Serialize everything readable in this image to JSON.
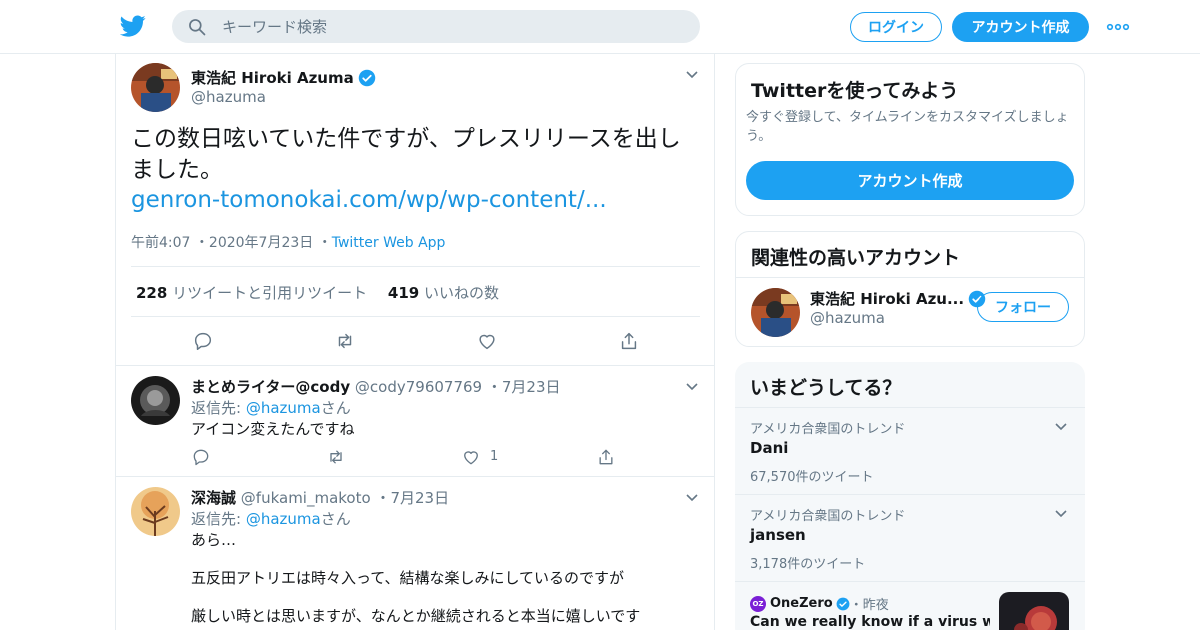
{
  "header": {
    "search_placeholder": "キーワード検索",
    "login_label": "ログイン",
    "signup_label": "アカウント作成"
  },
  "tweet": {
    "author_name": "東浩紀 Hiroki Azuma",
    "author_handle": "@hazuma",
    "text": "この数日呟いていた件ですが、プレスリリースを出しました。",
    "link": "genron-tomonokai.com/wp/wp-content/...",
    "time": "午前4:07",
    "date": "2020年7月23日",
    "source": "Twitter Web App",
    "retweet_count": "228",
    "retweet_label": "リツイートと引用リツイート",
    "like_count": "419",
    "like_label": "いいねの数"
  },
  "replies": [
    {
      "name": "まとめライター@cody",
      "handle": "@cody79607769",
      "date": "7月23日",
      "reply_to_prefix": "返信先: ",
      "reply_to_handle": "@hazuma",
      "reply_to_suffix": "さん",
      "text": "アイコン変えたんですね",
      "like_count": "1"
    },
    {
      "name": "深海誠",
      "handle": "@fukami_makoto",
      "date": "7月23日",
      "reply_to_prefix": "返信先: ",
      "reply_to_handle": "@hazuma",
      "reply_to_suffix": "さん",
      "line1": "あら…",
      "line2": "五反田アトリエは時々入って、結構な楽しみにしているのですが",
      "line3": "厳しい時とは思いますが、なんとか継続されると本当に嬉しいです"
    }
  ],
  "sidebar": {
    "signup_card": {
      "title": "Twitterを使ってみよう",
      "desc": "今すぐ登録して、タイムラインをカスタマイズしましょう。",
      "button": "アカウント作成"
    },
    "related": {
      "title": "関連性の高いアカウント",
      "name": "東浩紀 Hiroki Azu...",
      "handle": "@hazuma",
      "follow_label": "フォロー"
    },
    "trends": {
      "title": "いまどうしてる？",
      "items": [
        {
          "context": "アメリカ合衆国のトレンド",
          "name": "Dani",
          "count": "67,570件のツイート"
        },
        {
          "context": "アメリカ合衆国のトレンド",
          "name": "jansen",
          "count": "3,178件のツイート"
        }
      ],
      "news": {
        "source": "OneZero",
        "badge": "OZ",
        "time": "昨夜",
        "headline": "Can we really know if a virus was"
      }
    }
  },
  "colors": {
    "accent": "#1da1f2",
    "link": "#1b95e0",
    "muted": "#657786",
    "border": "#e6ecf0"
  }
}
